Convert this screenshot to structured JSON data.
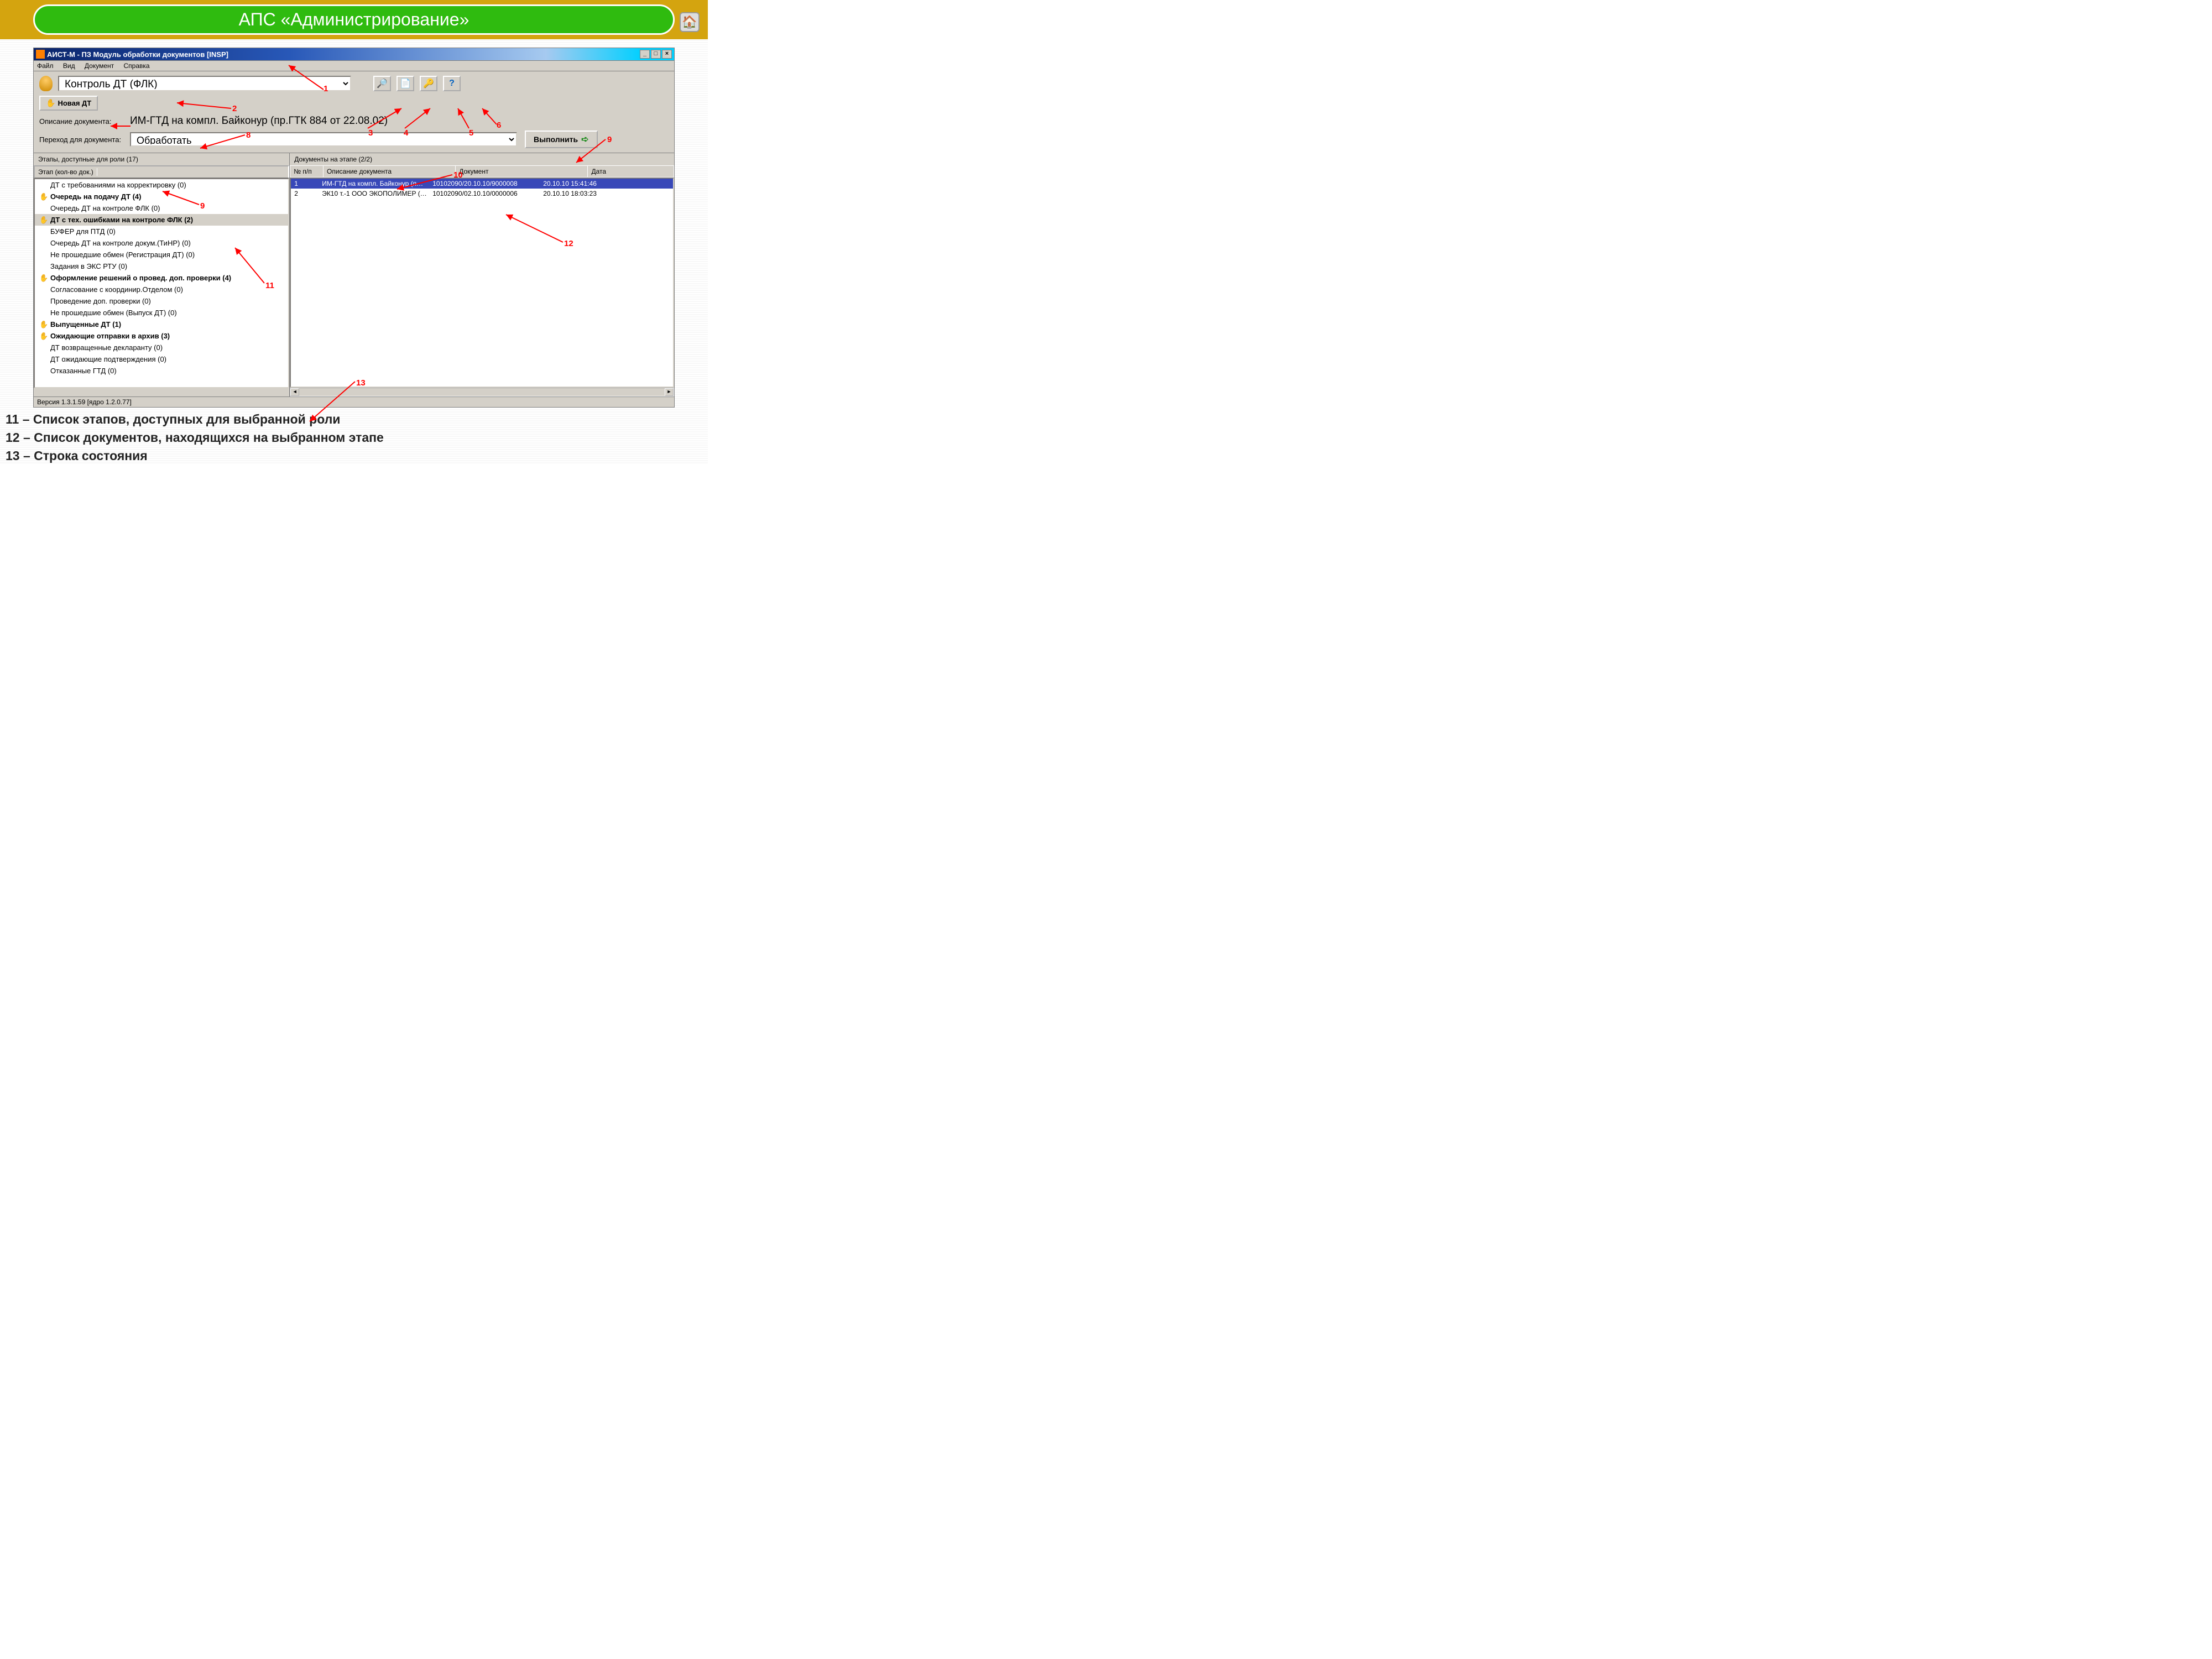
{
  "banner": {
    "title": "АПС «Администрирование»"
  },
  "window": {
    "title": "АИСТ-М - ПЗ Модуль обработки документов [INSP]",
    "menu": [
      "Файл",
      "Вид",
      "Документ",
      "Справка"
    ]
  },
  "toolbar": {
    "role_select": "Контроль ДТ (ФЛК)",
    "new_doc_label": "Новая ДТ",
    "desc_label": "Описание документа:",
    "desc_value": "ИМ-ГТД на компл. Байконур (пр.ГТК 884 от 22.08.02)",
    "action_label": "Переход для документа:",
    "action_value": "Обработать",
    "exec_label": "Выполнить"
  },
  "left": {
    "title": "Этапы, доступные для роли (17)",
    "header": "Этап (кол-во док.)",
    "items": [
      {
        "label": "ДТ с требованиями на корректировку (0)",
        "bold": false,
        "icon": false
      },
      {
        "label": "Очередь на подачу ДТ (4)",
        "bold": true,
        "icon": true
      },
      {
        "label": "Очередь ДТ на контроле ФЛК (0)",
        "bold": false,
        "icon": false
      },
      {
        "label": "ДТ с тех. ошибками на контроле ФЛК (2)",
        "bold": true,
        "icon": true,
        "selected": true
      },
      {
        "label": "БУФЕР для ПТД (0)",
        "bold": false,
        "icon": false
      },
      {
        "label": "Очередь ДТ на контроле докум.(ТиНР) (0)",
        "bold": false,
        "icon": false
      },
      {
        "label": "Не прошедшие обмен (Регистрация ДТ) (0)",
        "bold": false,
        "icon": false
      },
      {
        "label": "Задания в ЭКС РТУ (0)",
        "bold": false,
        "icon": false
      },
      {
        "label": "Оформление решений о провед. доп. проверки (4)",
        "bold": true,
        "icon": true
      },
      {
        "label": "Согласование с координир.Отделом (0)",
        "bold": false,
        "icon": false
      },
      {
        "label": "Проведение доп. проверки (0)",
        "bold": false,
        "icon": false
      },
      {
        "label": "Не прошедшие обмен (Выпуск ДТ) (0)",
        "bold": false,
        "icon": false
      },
      {
        "label": "Выпущенные ДТ (1)",
        "bold": true,
        "icon": true
      },
      {
        "label": "Ожидающие отправки в архив (3)",
        "bold": true,
        "icon": true
      },
      {
        "label": "ДТ возвращенные декларанту (0)",
        "bold": false,
        "icon": false
      },
      {
        "label": "ДТ ожидающие подтверждения (0)",
        "bold": false,
        "icon": false
      },
      {
        "label": "Отказанные ГТД (0)",
        "bold": false,
        "icon": false
      }
    ]
  },
  "right": {
    "title": "Документы на этапе (2/2)",
    "headers": [
      "№ п/п",
      "Описание документа",
      "Документ",
      "Дата"
    ],
    "rows": [
      {
        "num": "1",
        "desc": "ИМ-ГТД на компл. Байконур (п…",
        "doc": "10102090/20.10.10/9000008",
        "date": "20.10.10 15:41:46",
        "selected": true
      },
      {
        "num": "2",
        "desc": "ЭК10 т.-1 ООО ЭКОПОЛИМЕР (…",
        "doc": "10102090/02.10.10/0000006",
        "date": "20.10.10 18:03:23",
        "selected": false
      }
    ]
  },
  "status": "Версия 1.3.1.59 [ядро 1.2.0.77]",
  "annotations": {
    "a1": "1",
    "a2": "2",
    "a3": "3",
    "a4": "4",
    "a5": "5",
    "a6": "6",
    "a8": "8",
    "a9": "9",
    "a9b": "9",
    "a10": "10",
    "a11": "11",
    "a12": "12",
    "a13": "13"
  },
  "explain": {
    "l11": "11 – Список этапов, доступных для выбранной роли",
    "l12": "12 – Список документов, находящихся на выбранном этапе",
    "l13": "13 – Строка состояния"
  }
}
